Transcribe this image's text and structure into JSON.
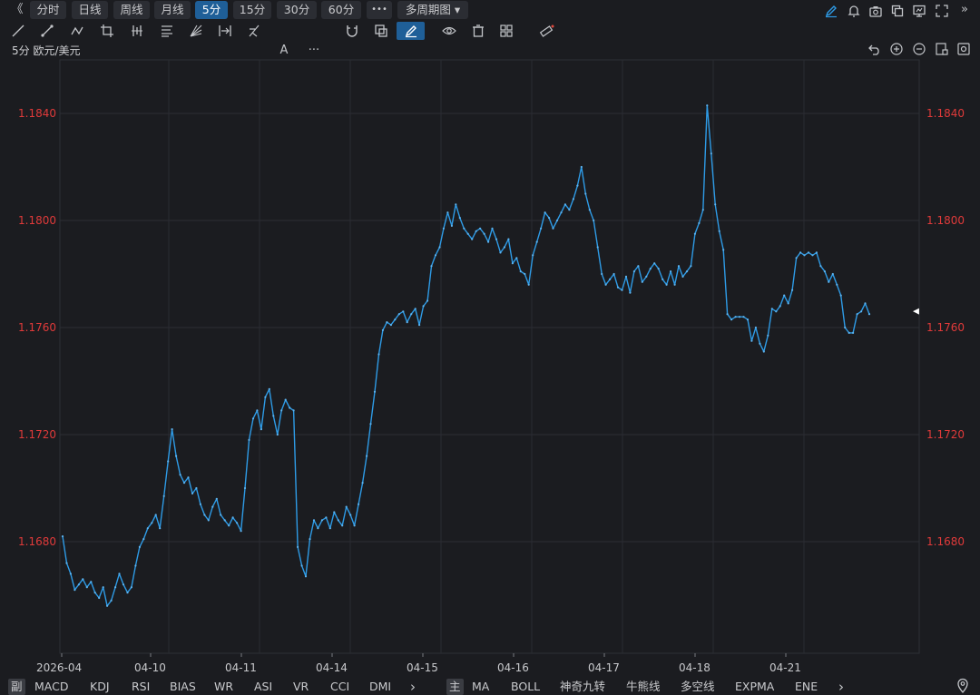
{
  "toolbar": {
    "collapse_label": "《",
    "periods": [
      {
        "label": "分时",
        "active": false
      },
      {
        "label": "日线",
        "active": false
      },
      {
        "label": "周线",
        "active": false
      },
      {
        "label": "月线",
        "active": false
      },
      {
        "label": "5分",
        "active": true
      },
      {
        "label": "15分",
        "active": false
      },
      {
        "label": "30分",
        "active": false
      },
      {
        "label": "60分",
        "active": false
      }
    ],
    "more_label": "•••",
    "multi_period_label": "多周期图 ▾",
    "right_icons": [
      "pen-icon",
      "bell-icon",
      "camera-icon",
      "copy-icon",
      "monitor-icon",
      "fullscreen-icon",
      "expand-icon"
    ]
  },
  "title": "5分 欧元/美元",
  "chart_data": {
    "type": "line",
    "title": "5分 欧元/美元",
    "ylim": [
      1.165,
      1.1855
    ],
    "yticks": [
      "1.1840",
      "1.1800",
      "1.1760",
      "1.1720",
      "1.1680"
    ],
    "xticks": [
      "2026-04",
      "04-10",
      "04-11",
      "04-14",
      "04-15",
      "04-16",
      "04-17",
      "04-18",
      "04-21"
    ],
    "line_color": "#2e9be6",
    "grid": true,
    "series": [
      {
        "name": "",
        "values": [
          1.1682,
          1.1672,
          1.1668,
          1.1662,
          1.1664,
          1.1666,
          1.1663,
          1.1665,
          1.1661,
          1.1659,
          1.1663,
          1.1656,
          1.1658,
          1.1663,
          1.1668,
          1.1664,
          1.1661,
          1.1663,
          1.1671,
          1.1678,
          1.1681,
          1.1685,
          1.1687,
          1.169,
          1.1685,
          1.1697,
          1.171,
          1.1722,
          1.1712,
          1.1705,
          1.1702,
          1.1704,
          1.1698,
          1.17,
          1.1694,
          1.169,
          1.1688,
          1.1693,
          1.1696,
          1.169,
          1.1688,
          1.1686,
          1.1689,
          1.1687,
          1.1684,
          1.17,
          1.1718,
          1.1726,
          1.1729,
          1.1722,
          1.1734,
          1.1737,
          1.1727,
          1.172,
          1.1729,
          1.1733,
          1.173,
          1.1729,
          1.1678,
          1.1671,
          1.1667,
          1.1681,
          1.1688,
          1.1685,
          1.1688,
          1.1689,
          1.1685,
          1.1691,
          1.1688,
          1.1686,
          1.1693,
          1.169,
          1.1686,
          1.1694,
          1.1702,
          1.1712,
          1.1724,
          1.1736,
          1.175,
          1.1759,
          1.1762,
          1.1761,
          1.1763,
          1.1765,
          1.1766,
          1.1762,
          1.1765,
          1.1767,
          1.1761,
          1.1768,
          1.177,
          1.1783,
          1.1787,
          1.179,
          1.1797,
          1.1803,
          1.1798,
          1.1806,
          1.1801,
          1.1797,
          1.1795,
          1.1793,
          1.1796,
          1.1797,
          1.1795,
          1.1792,
          1.1797,
          1.1793,
          1.1788,
          1.179,
          1.1793,
          1.1784,
          1.1786,
          1.1781,
          1.178,
          1.1776,
          1.1787,
          1.1792,
          1.1797,
          1.1803,
          1.1801,
          1.1797,
          1.18,
          1.1803,
          1.1806,
          1.1804,
          1.1808,
          1.1813,
          1.182,
          1.181,
          1.1804,
          1.18,
          1.179,
          1.178,
          1.1776,
          1.1778,
          1.178,
          1.1775,
          1.1774,
          1.1779,
          1.1773,
          1.1781,
          1.1783,
          1.1777,
          1.1779,
          1.1782,
          1.1784,
          1.1782,
          1.1778,
          1.1776,
          1.1781,
          1.1776,
          1.1783,
          1.1779,
          1.1781,
          1.1783,
          1.1795,
          1.1799,
          1.1804,
          1.1843,
          1.1825,
          1.1806,
          1.1796,
          1.1789,
          1.1765,
          1.1763,
          1.1764,
          1.1764,
          1.1764,
          1.1763,
          1.1755,
          1.176,
          1.1754,
          1.1751,
          1.1757,
          1.1767,
          1.1766,
          1.1768,
          1.1772,
          1.1769,
          1.1774,
          1.1786,
          1.1788,
          1.1787,
          1.1788,
          1.1787,
          1.1788,
          1.1783,
          1.1781,
          1.1777,
          1.178,
          1.1776,
          1.1772,
          1.176,
          1.1758,
          1.1758,
          1.1765,
          1.1766,
          1.1769,
          1.1765
        ]
      }
    ]
  },
  "price_marker": "◀",
  "right_tools": [
    "undo-icon",
    "zoom-in-icon",
    "zoom-out-icon",
    "layout-icon",
    "settings-icon"
  ],
  "indicators_left": [
    "副",
    "MACD",
    "KDJ",
    "RSI",
    "BIAS",
    "WR",
    "ASI",
    "VR",
    "CCI",
    "DMI"
  ],
  "indicators_right": [
    "主",
    "MA",
    "BOLL",
    "神奇九转",
    "牛熊线",
    "多空线",
    "EXPMA",
    "ENE"
  ],
  "nav_arrow": "›"
}
